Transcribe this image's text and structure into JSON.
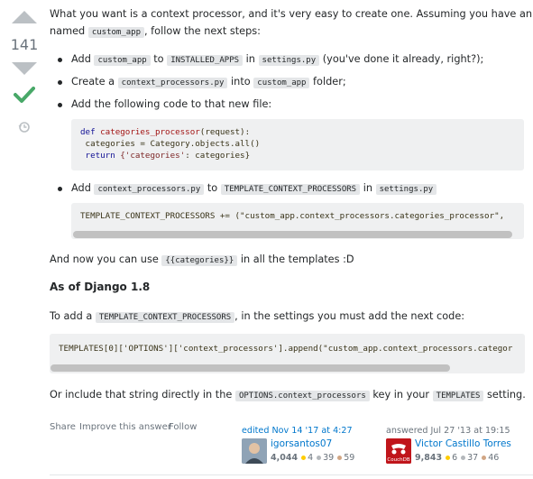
{
  "vote": {
    "score": "141",
    "up_icon": "arrow-up-icon",
    "down_icon": "arrow-down-icon",
    "accepted_icon": "checkmark-icon",
    "history_icon": "history-icon"
  },
  "intro": {
    "t1": "What you want is a context processor, and it's very easy to create one. Assuming you have an app",
    "t2": "named ",
    "code1": "custom_app",
    "t3": ", follow the next steps:"
  },
  "steps": [
    {
      "a": "Add ",
      "c1": "custom_app",
      "b": " to ",
      "c2": "INSTALLED_APPS",
      "c": " in ",
      "c3": "settings.py",
      "d": " (you've done it already, right?);"
    },
    {
      "a": "Create a ",
      "c1": "context_processors.py",
      "b": " into ",
      "c2": "custom_app",
      "c": " folder;"
    },
    {
      "a": "Add the following code to that new file:"
    },
    {
      "a": "Add ",
      "c1": "context_processors.py",
      "b": " to ",
      "c2": "TEMPLATE_CONTEXT_PROCESSORS",
      "c": " in ",
      "c3": "settings.py"
    }
  ],
  "code_block_1": {
    "line1_kw": "def ",
    "line1_fn": "categories_processor",
    "line1_rest": "(request):",
    "line2": " categories = Category.objects.all()",
    "line3_kw": " return ",
    "line3_str": "{'categories'",
    "line3_rest": ": categories}"
  },
  "code_block_2": {
    "line": "TEMPLATE_CONTEXT_PROCESSORS += (\"custom_app.context_processors.categories_processor\","
  },
  "use_line": {
    "a": "And now you can use ",
    "c1": "{{categories}}",
    "b": " in all the templates :D"
  },
  "heading": "As of Django 1.8",
  "django_line": {
    "a": "To add a ",
    "c1": "TEMPLATE_CONTEXT_PROCESSORS",
    "b": ", in the settings you must add the next code:"
  },
  "code_block_3": {
    "line": "TEMPLATES[0]['OPTIONS']['context_processors'].append(\"custom_app.context_processors.categor"
  },
  "include_line": {
    "a": "Or include that string directly in the ",
    "c1": "OPTIONS.context_processors",
    "b": " key in your ",
    "c2": "TEMPLATES",
    "c": " setting."
  },
  "menu": {
    "share": "Share",
    "improve": "Improve this answer",
    "follow": "Follow"
  },
  "editor": {
    "label": "edited Nov 14 '17 at 4:27",
    "name": "igorsantos07",
    "rep": "4,044",
    "gold": "4",
    "silver": "39",
    "bronze": "59"
  },
  "author": {
    "label": "answered Jul 27 '13 at 19:15",
    "name": "Victor Castillo Torres",
    "rep": "9,843",
    "gold": "6",
    "silver": "37",
    "bronze": "46",
    "avatar_text": "CouchDB"
  },
  "colors": {
    "accent": "#0077cc",
    "accepted": "#48a868",
    "vote": "#bbc0c4"
  }
}
